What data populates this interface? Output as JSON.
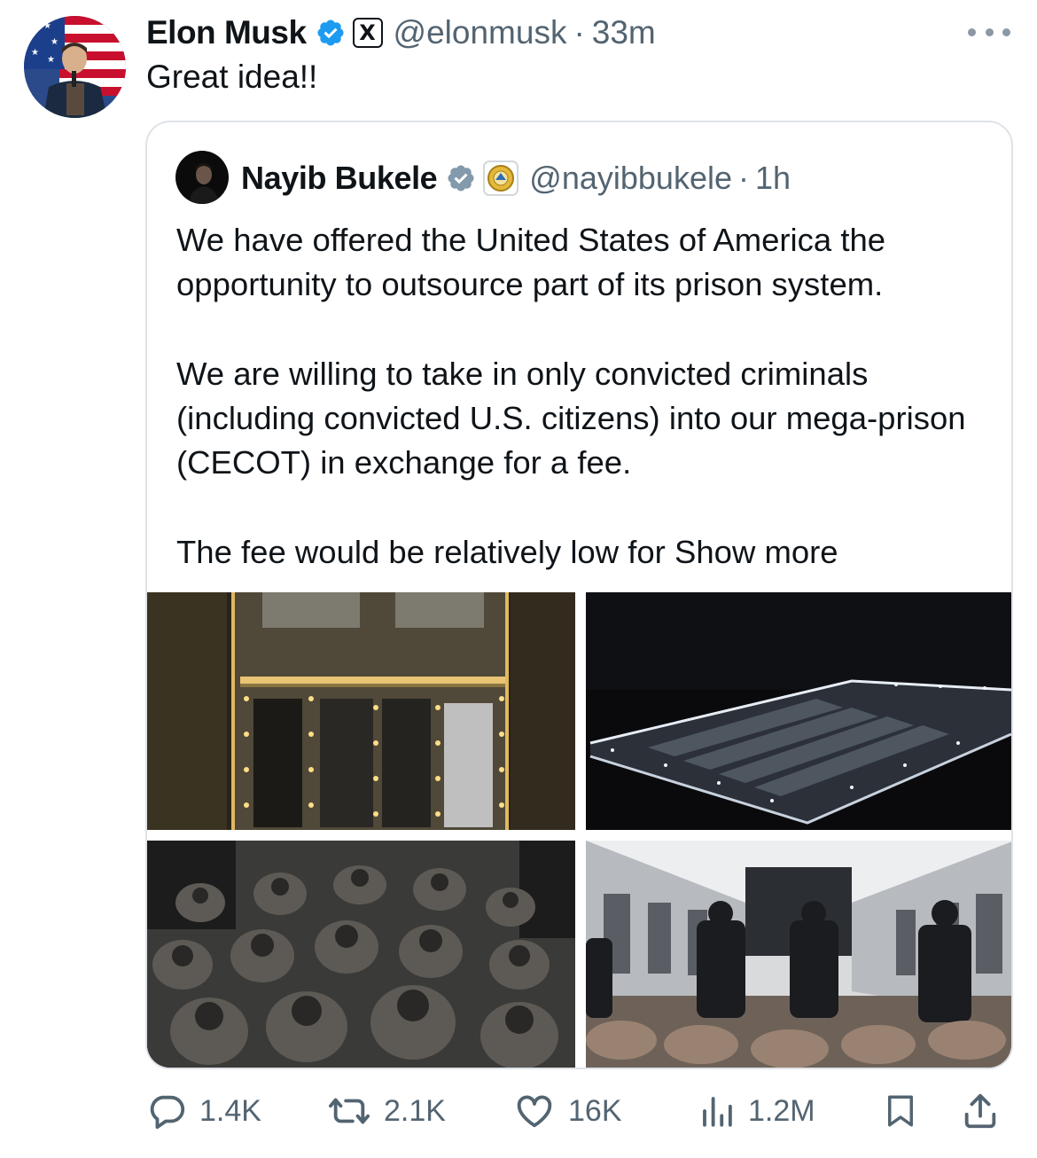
{
  "tweet": {
    "author_name": "Elon Musk",
    "handle": "@elonmusk",
    "separator": "·",
    "time": "33m",
    "text": "Great idea!!",
    "x_badge": "X",
    "icons": {
      "verified": "verified-badge-icon",
      "x": "x-logo-icon",
      "more": "more-options-icon"
    },
    "accent_color": "#1d9bf0"
  },
  "quote": {
    "author_name": "Nayib Bukele",
    "handle": "@nayibbukele",
    "separator": "·",
    "time": "1h",
    "paragraph1": "We have offered the United States of America the opportunity to outsource part of its prison system.",
    "paragraph2": "We are willing to take in only convicted criminals (including convicted U.S. citizens) into our mega-prison (CECOT) in exchange for a fee.",
    "paragraph3": "The fee would be relatively low for",
    "show_more": "Show more",
    "icons": {
      "verified": "verified-badge-icon",
      "affiliate": "government-seal-icon"
    },
    "media": [
      {
        "depicts": "aerial-prison-complex-night"
      },
      {
        "depicts": "prison-complex-perimeter-night"
      },
      {
        "depicts": "inmates-seated-rows"
      },
      {
        "depicts": "guards-in-cell-block"
      }
    ]
  },
  "actions": {
    "replies": "1.4K",
    "reposts": "2.1K",
    "likes": "16K",
    "views": "1.2M",
    "icons": [
      "reply-icon",
      "repost-icon",
      "like-icon",
      "views-icon",
      "bookmark-icon",
      "share-icon"
    ]
  }
}
